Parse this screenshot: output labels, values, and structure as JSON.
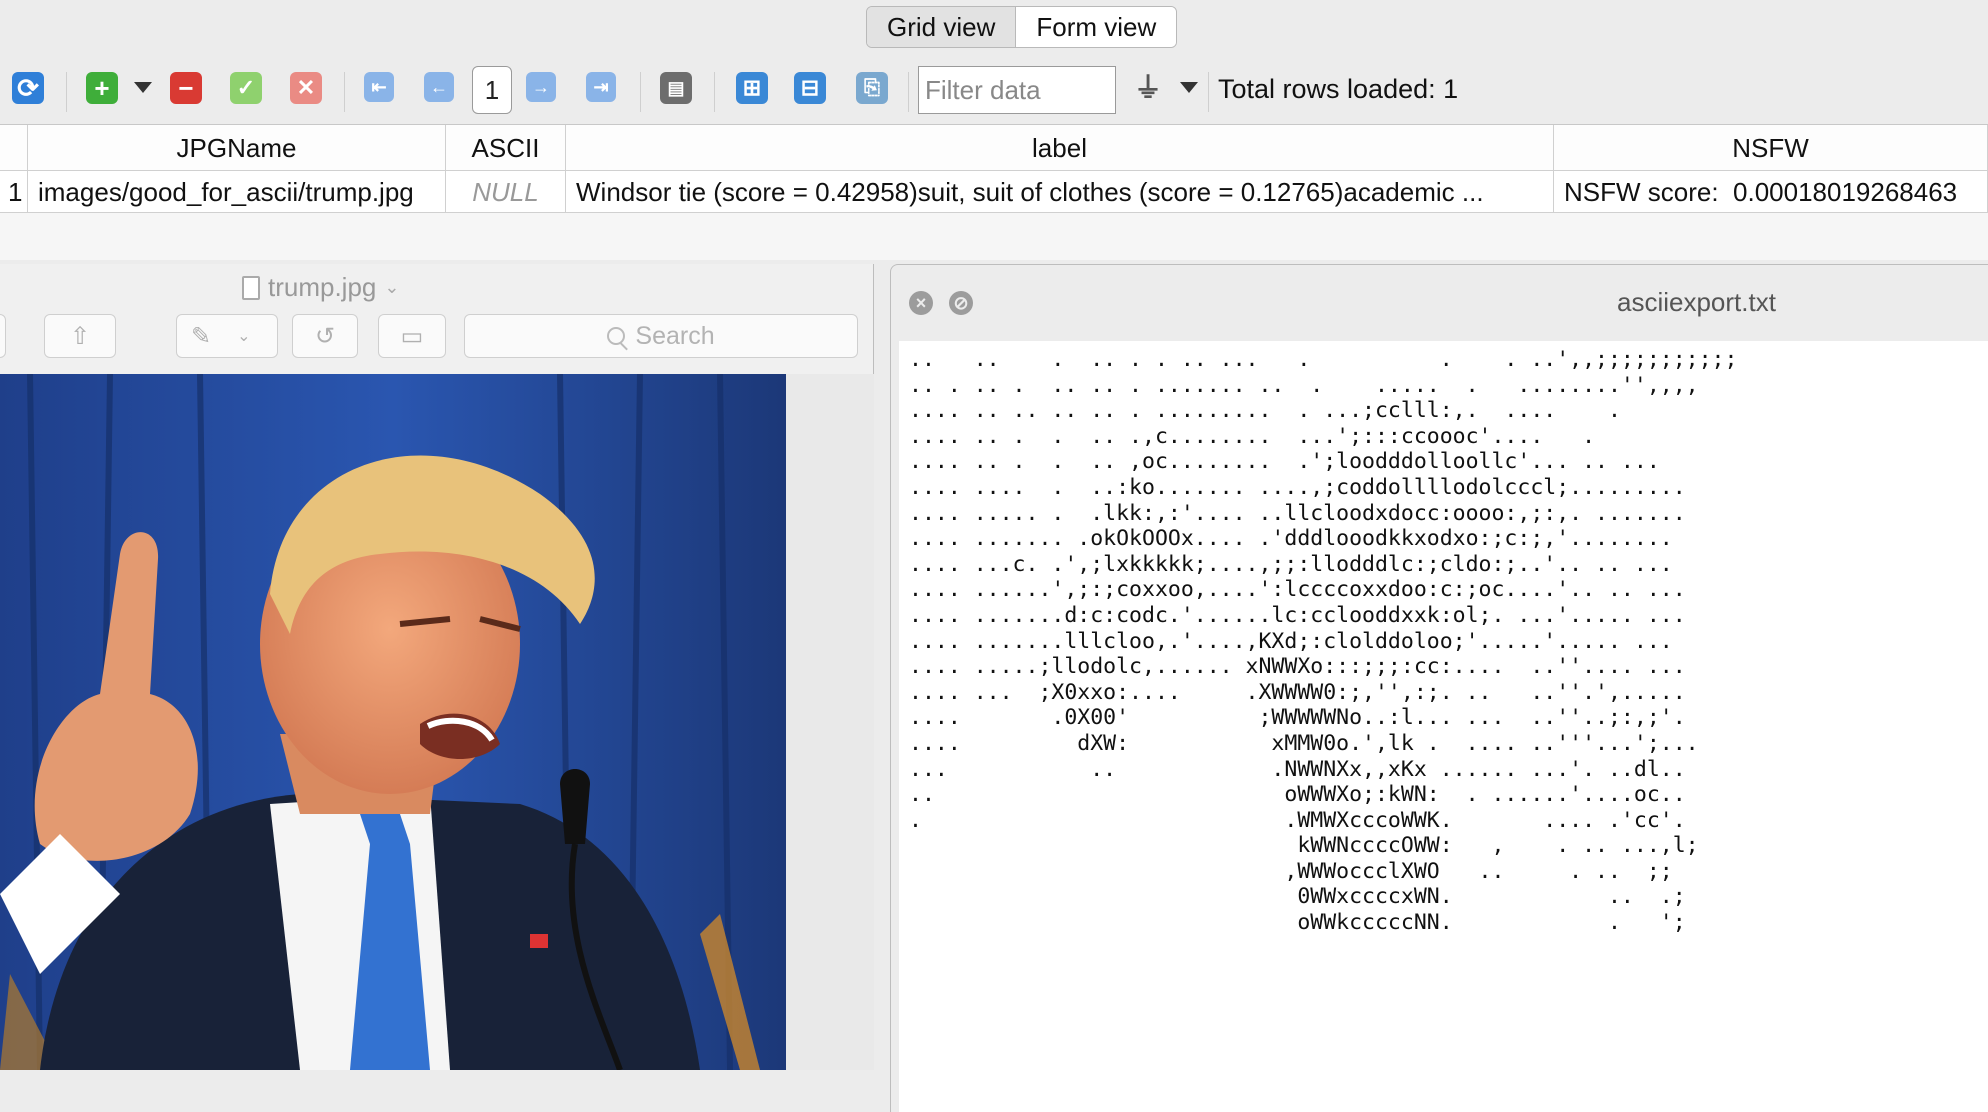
{
  "view_tabs": {
    "grid_view": "Grid view",
    "form_view": "Form view"
  },
  "toolbar": {
    "page_number": "1",
    "filter_placeholder": "Filter data",
    "total_rows": "Total rows loaded: 1",
    "icons": [
      "refresh-icon",
      "add-row-icon",
      "dropdown-caret-icon",
      "delete-row-icon",
      "commit-icon",
      "rollback-icon",
      "first-page-icon",
      "previous-page-icon",
      "next-page-icon",
      "last-page-icon",
      "print-icon",
      "expand-icon",
      "collapse-icon",
      "export-icon",
      "filter-icon"
    ]
  },
  "grid": {
    "columns": [
      "JPGName",
      "ASCII",
      "label",
      "NSFW"
    ],
    "rows": [
      {
        "row_number": "1",
        "JPGName": "images/good_for_ascii/trump.jpg",
        "ASCII": "NULL",
        "label": "Windsor tie (score = 0.42958)suit, suit of clothes (score = 0.12765)academic ...",
        "NSFW": "NSFW score:  0.00018019268463"
      }
    ]
  },
  "preview_window": {
    "title": "trump.jpg",
    "search_placeholder": "Search"
  },
  "text_window": {
    "title": "asciiexport.txt",
    "content": "..   ..    .  .. . . .. ...   .          .    . ..',,;;;;;;;;;;;\n.. . .. .  .. .. . ....... ..  .    .....  .   ........'',,,,\n.... .. .. .. .. . .........  . ...;cclll:,.  ....    .\n.... .. .  .  .. .,c........  ...';:::ccoooc'....   .\n.... .. .  .  .. ,oc........  .';loodddolloollc'... .. ...\n.... ....  .  ..:ko....... ....,;coddollllodolcccl;.........\n.... ..... .  .lkk:,:'.... ..llcloodxdocc:oooo:,;:,. .......\n.... ....... .okOkOOOx.... .'dddlooodkkxodxo:;c:;,'........\n.... ...c. .',;lxkkkkk;....,;;:llodddlc:;cldo:;..'.. .. ...\n.... ......',;:;coxxoo,....':lccccoxxdoo:c:;oc....'.. .. ...\n.... .......d:c:codc.'......lc:cclooddxxk:ol;. ...'..... ...\n.... .......lllcloo,.'....,KXd;:clolddoloo;'.....'..... ...\n.... .....;llodolc,...... xNWWXo:::;;;:cc:....  ..''.... ...\n.... ...  ;X0xxo:....     .XWWWW0:;,'',:;. ..   ..''.',.....\n....       .0X00'          ;WWWWWNo..:l... ...  ..''..;:,;'.\n....         dXW:           xMMW0o.',lk .  .... ..'''...';...\n...           ..            .NWWNXx,,xKx ...... ...'. ..dl..\n..                           oWWWXo;:kWN:  . ......'....oc..\n.                            .WMWXcccoWWK.       .... .'cc'.\n                              kWWNccccOWW:   ,    . .. ...,l;\n                             ,WWWoccclXWO   ..     . ..  ;;\n                              0WWxccccxWN.            ..  .;\n                              oWWkcccccNN.            .   ';"
  }
}
